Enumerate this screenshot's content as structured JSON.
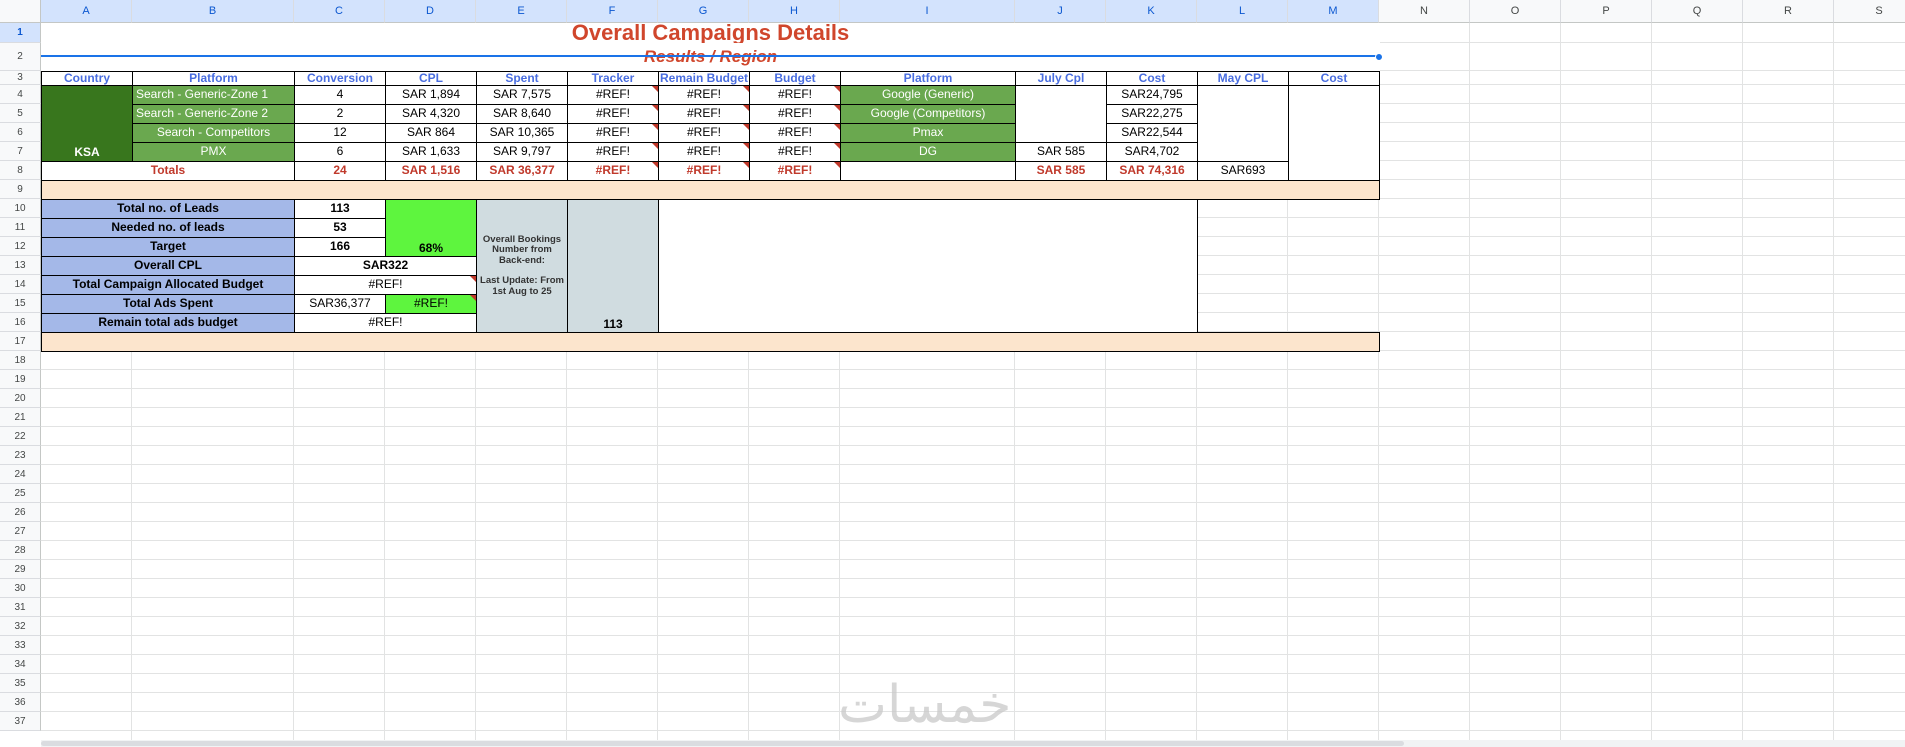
{
  "columns": [
    "A",
    "B",
    "C",
    "D",
    "E",
    "F",
    "G",
    "H",
    "I",
    "J",
    "K",
    "L",
    "M",
    "N",
    "O",
    "P",
    "Q",
    "R",
    "S"
  ],
  "rows": [
    "1",
    "2",
    "3",
    "4",
    "5",
    "6",
    "7",
    "8",
    "9",
    "10",
    "11",
    "12",
    "13",
    "14",
    "15",
    "16",
    "17",
    "18",
    "19",
    "20",
    "21",
    "22",
    "23",
    "24",
    "25",
    "26",
    "27",
    "28",
    "29",
    "30",
    "31",
    "32",
    "33",
    "34",
    "35",
    "36",
    "37"
  ],
  "title": "Overall Campaigns Details",
  "subtitle": "Results / Region",
  "headers": {
    "country": "Country",
    "platform": "Platform",
    "conversion": "Conversion",
    "cpl": "CPL",
    "spent": "Spent",
    "tracker": "Tracker",
    "remain_budget": "Remain Budget",
    "budget": "Budget",
    "platform2": "Platform",
    "july_cpl": "July Cpl",
    "cost": "Cost",
    "may_cpl": "May CPL",
    "cost2": "Cost"
  },
  "country": "KSA",
  "rows_data": [
    {
      "platform": "Search - Generic-Zone 1",
      "conversion": "4",
      "cpl": "SAR  1,894",
      "spent": "SAR  7,575",
      "tracker": "#REF!",
      "remain": "#REF!",
      "budget": "#REF!",
      "platform2": "Google (Generic)",
      "july": "",
      "cost": "SAR24,795"
    },
    {
      "platform": "Search - Generic-Zone 2",
      "conversion": "2",
      "cpl": "SAR  4,320",
      "spent": "SAR  8,640",
      "tracker": "#REF!",
      "remain": "#REF!",
      "budget": "#REF!",
      "platform2": "Google (Competitors)",
      "july": "",
      "cost": "SAR22,275"
    },
    {
      "platform": "Search - Competitors",
      "conversion": "12",
      "cpl": "SAR  864",
      "spent": "SAR  10,365",
      "tracker": "#REF!",
      "remain": "#REF!",
      "budget": "#REF!",
      "platform2": "Pmax",
      "july": "",
      "cost": "SAR22,544"
    },
    {
      "platform": "PMX",
      "conversion": "6",
      "cpl": "SAR  1,633",
      "spent": "SAR  9,797",
      "tracker": "#REF!",
      "remain": "#REF!",
      "budget": "#REF!",
      "platform2": "DG",
      "july": "SAR  585",
      "cost": "SAR4,702"
    }
  ],
  "totals": {
    "label": "Totals",
    "conversion": "24",
    "cpl": "SAR  1,516",
    "spent": "SAR  36,377",
    "tracker": "#REF!",
    "remain": "#REF!",
    "budget": "#REF!",
    "july": "SAR  585",
    "cost": "SAR  74,316",
    "may_cpl": "SAR693"
  },
  "summary": {
    "total_leads_label": "Total no. of Leads",
    "total_leads": "113",
    "needed_leads_label": "Needed no. of leads",
    "needed_leads": "53",
    "target_label": "Target",
    "target": "166",
    "target_pct": "68%",
    "overall_cpl_label": "Overall CPL",
    "overall_cpl": "SAR322",
    "allocated_budget_label": "Total Campaign Allocated Budget",
    "allocated_budget": "#REF!",
    "ads_spent_label": "Total Ads Spent",
    "ads_spent": "SAR36,377",
    "ads_spent_ref": "#REF!",
    "remain_budget_label": "Remain total ads budget",
    "remain_budget": "#REF!"
  },
  "bookings": {
    "text": "Overall Bookings Number from Back-end:\n\nLast Update: From 1st Aug to 25",
    "value": "113"
  },
  "watermark": "خمسات"
}
